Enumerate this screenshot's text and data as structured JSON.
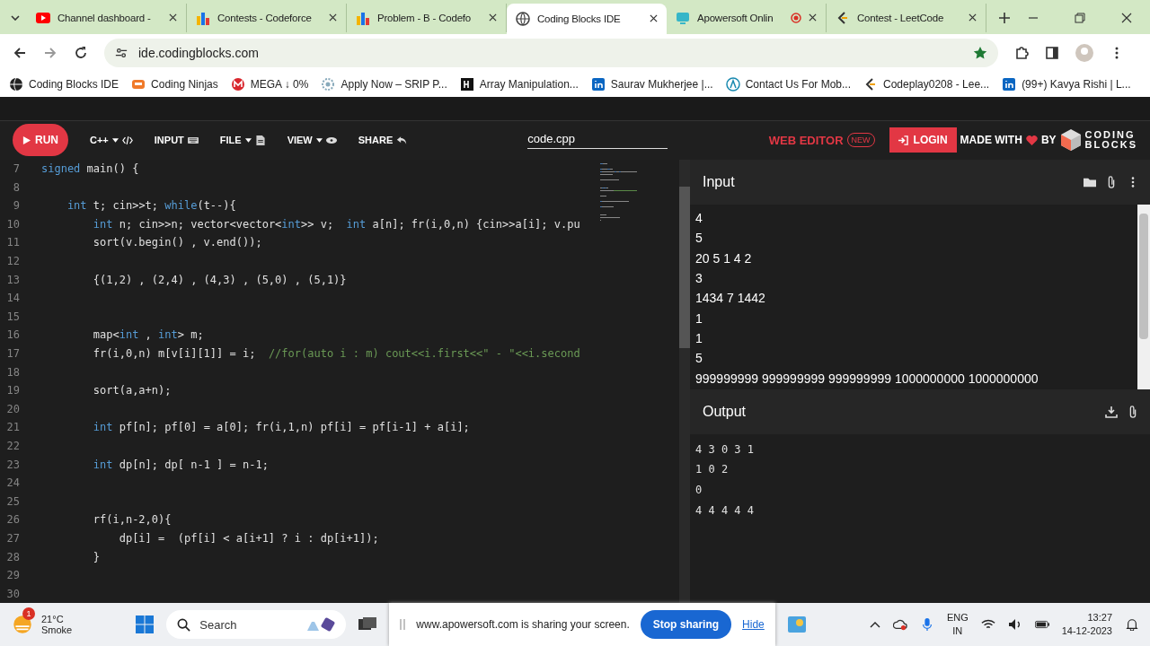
{
  "browser": {
    "tabs": [
      {
        "title": "Channel dashboard -",
        "selected": false
      },
      {
        "title": "Contests - Codeforce",
        "selected": false
      },
      {
        "title": "Problem - B - Codefo",
        "selected": false
      },
      {
        "title": "Coding Blocks IDE",
        "selected": true
      },
      {
        "title": "Apowersoft Onlin",
        "selected": false
      },
      {
        "title": "Contest - LeetCode",
        "selected": false
      }
    ],
    "url": "ide.codingblocks.com",
    "bookmarks": [
      "Coding Blocks IDE",
      "Coding Ninjas",
      "MEGA ↓ 0%",
      "Apply Now – SRIP P...",
      "Array Manipulation...",
      "Saurav Mukherjee |...",
      "Contact Us For Mob...",
      "Codeplay0208 - Lee...",
      "(99+) Kavya Rishi | L..."
    ]
  },
  "toolbar": {
    "run": "RUN",
    "menus": [
      "C++",
      "INPUT",
      "FILE",
      "VIEW",
      "SHARE"
    ],
    "filename": "code.cpp",
    "web_editor": "WEB EDITOR",
    "new_badge": "NEW",
    "login": "LOGIN",
    "made_with": "MADE WITH",
    "by": "BY",
    "logo_top": "CODING",
    "logo_bottom": "BLOCKS"
  },
  "editor": {
    "lines": [
      {
        "n": "7",
        "tokens": [
          {
            "kind": "kw",
            "text": "signed"
          },
          {
            "kind": "plain",
            "text": " main() {"
          }
        ]
      },
      {
        "n": "8"
      },
      {
        "n": "9",
        "tokens": [
          {
            "kind": "kw",
            "text": "int"
          },
          {
            "kind": "plain",
            "text": " t; cin>>t; "
          },
          {
            "kind": "kw",
            "text": "while"
          },
          {
            "kind": "plain",
            "text": "(t--){"
          }
        ]
      },
      {
        "n": "10",
        "tokens": [
          {
            "kind": "kw",
            "text": "int"
          },
          {
            "kind": "plain",
            "text": " n; cin>>n; vector<vector<"
          },
          {
            "kind": "kw",
            "text": "int"
          },
          {
            "kind": "plain",
            "text": ">> v;  "
          },
          {
            "kind": "kw",
            "text": "int"
          },
          {
            "kind": "plain",
            "text": " a[n]; fr(i,0,n) {cin>>a[i]; v.pu"
          }
        ]
      },
      {
        "n": "11",
        "tokens": [
          {
            "kind": "plain",
            "text": "sort(v.begin() , v.end());"
          }
        ]
      },
      {
        "n": "12"
      },
      {
        "n": "13",
        "tokens": [
          {
            "kind": "plain",
            "text": "{(1,2) , (2,4) , (4,3) , (5,0) , (5,1)}"
          }
        ]
      },
      {
        "n": "14"
      },
      {
        "n": "15"
      },
      {
        "n": "16",
        "tokens": [
          {
            "kind": "plain",
            "text": "map<"
          },
          {
            "kind": "kw",
            "text": "int"
          },
          {
            "kind": "plain",
            "text": " , "
          },
          {
            "kind": "kw",
            "text": "int"
          },
          {
            "kind": "plain",
            "text": "> m;"
          }
        ]
      },
      {
        "n": "17",
        "tokens": [
          {
            "kind": "plain",
            "text": "fr(i,0,n) m[v[i][1]] = i;  "
          },
          {
            "kind": "comment",
            "text": "//for(auto i : m) cout<<i.first<<\" - \"<<i.second"
          }
        ]
      },
      {
        "n": "18"
      },
      {
        "n": "19",
        "tokens": [
          {
            "kind": "plain",
            "text": "sort(a,a+n);"
          }
        ]
      },
      {
        "n": "20"
      },
      {
        "n": "21",
        "tokens": [
          {
            "kind": "kw",
            "text": "int"
          },
          {
            "kind": "plain",
            "text": " pf[n]; pf[0] = a[0]; fr(i,1,n) pf[i] = pf[i-1] + a[i];"
          }
        ]
      },
      {
        "n": "22"
      },
      {
        "n": "23",
        "tokens": [
          {
            "kind": "kw",
            "text": "int"
          },
          {
            "kind": "plain",
            "text": " dp[n]; dp[ n-1 ] = n-1;"
          }
        ]
      },
      {
        "n": "24"
      },
      {
        "n": "25"
      },
      {
        "n": "26",
        "tokens": [
          {
            "kind": "plain",
            "text": "rf(i,n-2,0){"
          }
        ]
      },
      {
        "n": "27",
        "tokens": [
          {
            "kind": "plain",
            "text": "dp[i] =  (pf[i] < a[i+1] ? i : dp[i+1]);"
          }
        ]
      },
      {
        "n": "28",
        "tokens": [
          {
            "kind": "plain",
            "text": "}"
          }
        ]
      },
      {
        "n": "29"
      },
      {
        "n": "30"
      }
    ]
  },
  "input": {
    "title": "Input",
    "lines": [
      "4",
      "5",
      "20 5 1 4 2",
      "3",
      "1434 7 1442",
      "1",
      "1",
      "5",
      "999999999 999999999 999999999 1000000000 1000000000"
    ]
  },
  "output": {
    "title": "Output",
    "lines": [
      "4 3 0 3 1",
      "1 0 2",
      "0",
      "4 4 4 4 4"
    ]
  },
  "taskbar": {
    "temperature": "21°C",
    "weather": "Smoke",
    "badge": "1",
    "search": "Search",
    "sharing": "www.apowersoft.com is sharing your screen.",
    "stop": "Stop sharing",
    "hide": "Hide",
    "lang": "ENG",
    "region": "IN",
    "time": "13:27",
    "date": "14-12-2023"
  }
}
